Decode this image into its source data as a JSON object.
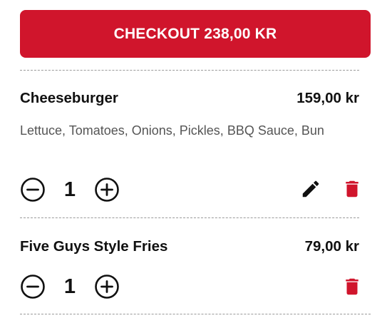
{
  "checkout": {
    "label": "CHECKOUT 238,00 KR"
  },
  "cart": {
    "items": [
      {
        "name": "Cheeseburger",
        "price": "159,00 kr",
        "description": "Lettuce, Tomatoes, Onions, Pickles, BBQ Sauce, Bun",
        "quantity": "1",
        "actions": [
          "edit-icon",
          "delete-icon"
        ]
      },
      {
        "name": "Five Guys Style Fries",
        "price": "79,00 kr",
        "quantity": "1",
        "actions": [
          "delete-icon"
        ]
      }
    ]
  },
  "colors": {
    "accent": "#d0152c",
    "text": "#111111",
    "muted": "#555555",
    "divider": "#9a9a9a"
  },
  "icons": {
    "decrease": "minus-circle-icon",
    "increase": "plus-circle-icon",
    "edit": "pencil-icon",
    "delete": "trash-icon"
  }
}
